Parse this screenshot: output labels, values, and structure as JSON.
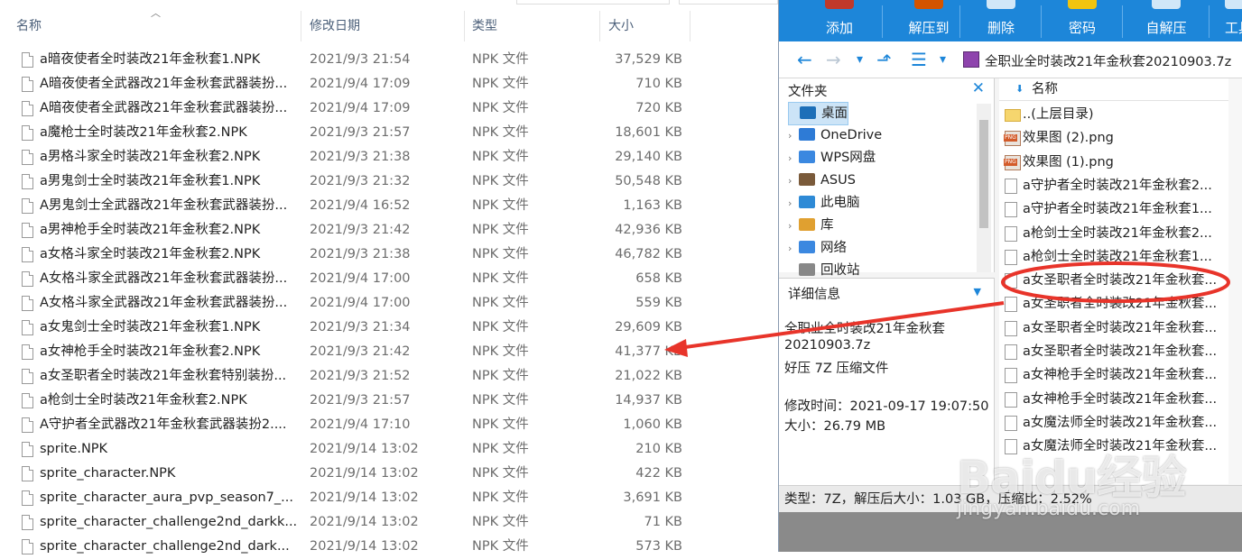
{
  "explorer": {
    "columns": {
      "name": "名称",
      "date": "修改日期",
      "type": "类型",
      "size": "大小"
    },
    "files": [
      {
        "name": "a暗夜使者全时装改21年金秋套1.NPK",
        "date": "2021/9/3 21:54",
        "type": "NPK 文件",
        "size": "37,529 KB"
      },
      {
        "name": "A暗夜使者全武器改21年金秋套武器装扮...",
        "date": "2021/9/4 17:09",
        "type": "NPK 文件",
        "size": "710 KB"
      },
      {
        "name": "A暗夜使者全武器改21年金秋套武器装扮...",
        "date": "2021/9/4 17:09",
        "type": "NPK 文件",
        "size": "720 KB"
      },
      {
        "name": "a魔枪士全时装改21年金秋套2.NPK",
        "date": "2021/9/3 21:57",
        "type": "NPK 文件",
        "size": "18,601 KB"
      },
      {
        "name": "a男格斗家全时装改21年金秋套2.NPK",
        "date": "2021/9/3 21:38",
        "type": "NPK 文件",
        "size": "29,140 KB"
      },
      {
        "name": "a男鬼剑士全时装改21年金秋套1.NPK",
        "date": "2021/9/3 21:32",
        "type": "NPK 文件",
        "size": "50,548 KB"
      },
      {
        "name": "A男鬼剑士全武器改21年金秋套武器装扮...",
        "date": "2021/9/4 16:52",
        "type": "NPK 文件",
        "size": "1,163 KB"
      },
      {
        "name": "a男神枪手全时装改21年金秋套2.NPK",
        "date": "2021/9/3 21:42",
        "type": "NPK 文件",
        "size": "42,936 KB"
      },
      {
        "name": "a女格斗家全时装改21年金秋套2.NPK",
        "date": "2021/9/3 21:38",
        "type": "NPK 文件",
        "size": "46,782 KB"
      },
      {
        "name": "A女格斗家全武器改21年金秋套武器装扮...",
        "date": "2021/9/4 17:00",
        "type": "NPK 文件",
        "size": "658 KB"
      },
      {
        "name": "A女格斗家全武器改21年金秋套武器装扮...",
        "date": "2021/9/4 17:00",
        "type": "NPK 文件",
        "size": "559 KB"
      },
      {
        "name": "a女鬼剑士全时装改21年金秋套1.NPK",
        "date": "2021/9/3 21:34",
        "type": "NPK 文件",
        "size": "29,609 KB"
      },
      {
        "name": "a女神枪手全时装改21年金秋套2.NPK",
        "date": "2021/9/3 21:42",
        "type": "NPK 文件",
        "size": "41,377 KB"
      },
      {
        "name": "a女圣职者全时装改21年金秋套特别装扮...",
        "date": "2021/9/3 21:52",
        "type": "NPK 文件",
        "size": "21,022 KB"
      },
      {
        "name": "a枪剑士全时装改21年金秋套2.NPK",
        "date": "2021/9/3 21:57",
        "type": "NPK 文件",
        "size": "14,937 KB"
      },
      {
        "name": "A守护者全武器改21年金秋套武器装扮2....",
        "date": "2021/9/4 17:10",
        "type": "NPK 文件",
        "size": "1,060 KB"
      },
      {
        "name": "sprite.NPK",
        "date": "2021/9/14 13:02",
        "type": "NPK 文件",
        "size": "210 KB"
      },
      {
        "name": "sprite_character.NPK",
        "date": "2021/9/14 13:02",
        "type": "NPK 文件",
        "size": "422 KB"
      },
      {
        "name": "sprite_character_aura_pvp_season7_...",
        "date": "2021/9/14 13:02",
        "type": "NPK 文件",
        "size": "3,691 KB"
      },
      {
        "name": "sprite_character_challenge2nd_darkk...",
        "date": "2021/9/14 13:02",
        "type": "NPK 文件",
        "size": "71 KB"
      },
      {
        "name": "sprite_character_challenge2nd_dark...",
        "date": "2021/9/14 13:02",
        "type": "NPK 文件",
        "size": "573 KB"
      }
    ]
  },
  "archiver": {
    "toolbar": [
      "添加",
      "解压到",
      "删除",
      "密码",
      "自解压",
      "工具"
    ],
    "toolbar_colors": [
      "#c0392b",
      "#d35400",
      "#ffffff",
      "#f1c40f",
      "#ffffff",
      "#ffffff"
    ],
    "path": "全职业全时装改21年金秋套20210903.7z",
    "nav": {
      "back": "←",
      "forward": "→",
      "down": "▾",
      "up": "⬏",
      "view": "☰"
    },
    "folder_panel": {
      "title": "文件夹",
      "close": "✕",
      "items": [
        {
          "label": "桌面",
          "icon": "desktop-icon",
          "color": "#1d6fb8",
          "arrow": ""
        },
        {
          "label": "OneDrive",
          "icon": "cloud-icon",
          "color": "#2e7bd6",
          "arrow": "›"
        },
        {
          "label": "WPS网盘",
          "icon": "cloud-icon",
          "color": "#3b88e0",
          "arrow": "›"
        },
        {
          "label": "ASUS",
          "icon": "user-icon",
          "color": "#7a5a3a",
          "arrow": "›"
        },
        {
          "label": "此电脑",
          "icon": "computer-icon",
          "color": "#2e8ad6",
          "arrow": "›"
        },
        {
          "label": "库",
          "icon": "library-icon",
          "color": "#e0a030",
          "arrow": "›"
        },
        {
          "label": "网络",
          "icon": "network-icon",
          "color": "#3b88e0",
          "arrow": "›"
        },
        {
          "label": "回收站",
          "icon": "recycle-bin-icon",
          "color": "#888888",
          "arrow": ""
        }
      ]
    },
    "detail": {
      "title": "详细信息",
      "lines": [
        "全职业全时装改21年金秋套",
        "20210903.7z",
        "好压 7Z 压缩文件",
        "",
        "修改时间：2021-09-17 19:07:50",
        "大小：26.79 MB"
      ]
    },
    "list": {
      "header": "名称",
      "items": [
        {
          "label": "..(上层目录)",
          "kind": "fold"
        },
        {
          "label": "效果图 (2).png",
          "kind": "png"
        },
        {
          "label": "效果图 (1).png",
          "kind": "png"
        },
        {
          "label": "a守护者全时装改21年金秋套2...",
          "kind": "file"
        },
        {
          "label": "a守护者全时装改21年金秋套1...",
          "kind": "file"
        },
        {
          "label": "a枪剑士全时装改21年金秋套2...",
          "kind": "file"
        },
        {
          "label": "a枪剑士全时装改21年金秋套1...",
          "kind": "file"
        },
        {
          "label": "a女圣职者全时装改21年金秋套...",
          "kind": "file"
        },
        {
          "label": "a女圣职者全时装改21年金秋套...",
          "kind": "file"
        },
        {
          "label": "a女圣职者全时装改21年金秋套...",
          "kind": "file"
        },
        {
          "label": "a女圣职者全时装改21年金秋套...",
          "kind": "file"
        },
        {
          "label": "a女神枪手全时装改21年金秋套...",
          "kind": "file"
        },
        {
          "label": "a女神枪手全时装改21年金秋套...",
          "kind": "file"
        },
        {
          "label": "a女魔法师全时装改21年金秋套...",
          "kind": "file"
        },
        {
          "label": "a女魔法师全时装改21年金秋套...",
          "kind": "file"
        }
      ]
    },
    "status": "类型：7Z，解压后大小：1.03 GB，压缩比：2.52%"
  },
  "watermark": {
    "logo": "Baidu经验",
    "sub": "jingyan.baidu.com"
  },
  "annotation_color": "#e8342a"
}
